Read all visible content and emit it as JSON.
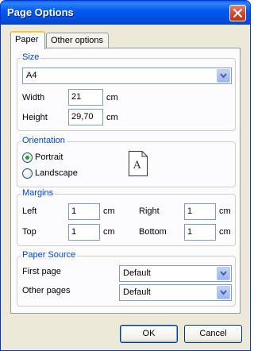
{
  "window": {
    "title": "Page Options"
  },
  "tabs": [
    {
      "label": "Paper",
      "active": true
    },
    {
      "label": "Other options",
      "active": false
    }
  ],
  "size": {
    "group_label": "Size",
    "paper_size": "A4",
    "width_label": "Width",
    "width_value": "21",
    "width_unit": "cm",
    "height_label": "Height",
    "height_value": "29,70",
    "height_unit": "cm"
  },
  "orientation": {
    "group_label": "Orientation",
    "portrait_label": "Portrait",
    "landscape_label": "Landscape",
    "selected": "Portrait",
    "preview_letter": "A"
  },
  "margins": {
    "group_label": "Margins",
    "left_label": "Left",
    "left_value": "1",
    "right_label": "Right",
    "right_value": "1",
    "top_label": "Top",
    "top_value": "1",
    "bottom_label": "Bottom",
    "bottom_value": "1",
    "unit": "cm"
  },
  "paper_source": {
    "group_label": "Paper Source",
    "first_page_label": "First page",
    "first_page_value": "Default",
    "other_pages_label": "Other pages",
    "other_pages_value": "Default"
  },
  "buttons": {
    "ok": "OK",
    "cancel": "Cancel"
  },
  "colors": {
    "title_bar": "#0058ee",
    "group_label": "#0046d5",
    "tab_highlight": "#ffc83c",
    "radio_dot": "#21a121"
  },
  "icons": {
    "close": "close-icon",
    "dropdown": "chevron-down-icon",
    "page_preview": "page-portrait-icon"
  }
}
